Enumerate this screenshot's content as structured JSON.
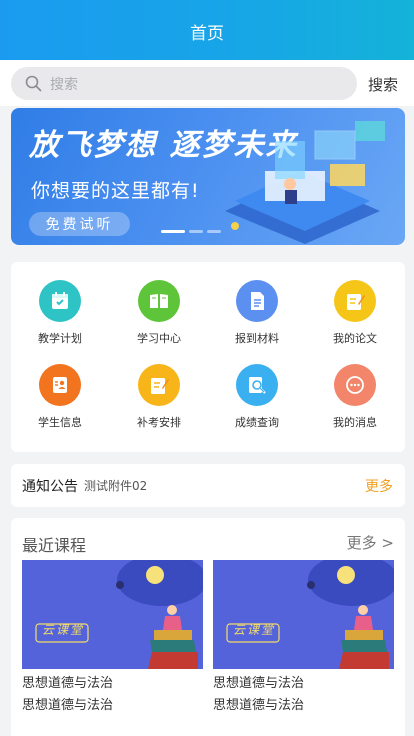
{
  "header": {
    "title": "首页"
  },
  "search": {
    "placeholder": "搜索",
    "button": "搜索"
  },
  "banner": {
    "title": "放飞梦想 逐梦未来",
    "subtitle": "你想要的这里都有!",
    "button": "免费试听"
  },
  "grid": {
    "items": [
      {
        "label": "教学计划",
        "icon": "calendar-icon",
        "color": "#2ec4c6"
      },
      {
        "label": "学习中心",
        "icon": "book-icon",
        "color": "#5ec43a"
      },
      {
        "label": "报到材料",
        "icon": "document-icon",
        "color": "#5b8ff0"
      },
      {
        "label": "我的论文",
        "icon": "edit-note-icon",
        "color": "#f5c518"
      },
      {
        "label": "学生信息",
        "icon": "id-card-icon",
        "color": "#f2741e"
      },
      {
        "label": "补考安排",
        "icon": "edit-note-icon",
        "color": "#f7b51a"
      },
      {
        "label": "成绩查询",
        "icon": "search-doc-icon",
        "color": "#3ab0f0"
      },
      {
        "label": "我的消息",
        "icon": "message-icon",
        "color": "#f2856a"
      }
    ]
  },
  "notice": {
    "title": "通知公告",
    "text": "测试附件02",
    "more": "更多"
  },
  "courses": {
    "title": "最近课程",
    "more": "更多 >",
    "thumb_text": "云课堂",
    "items": [
      {
        "name": "思想道德与法治",
        "subtitle": "思想道德与法治"
      },
      {
        "name": "思想道德与法治",
        "subtitle": "思想道德与法治"
      }
    ]
  }
}
